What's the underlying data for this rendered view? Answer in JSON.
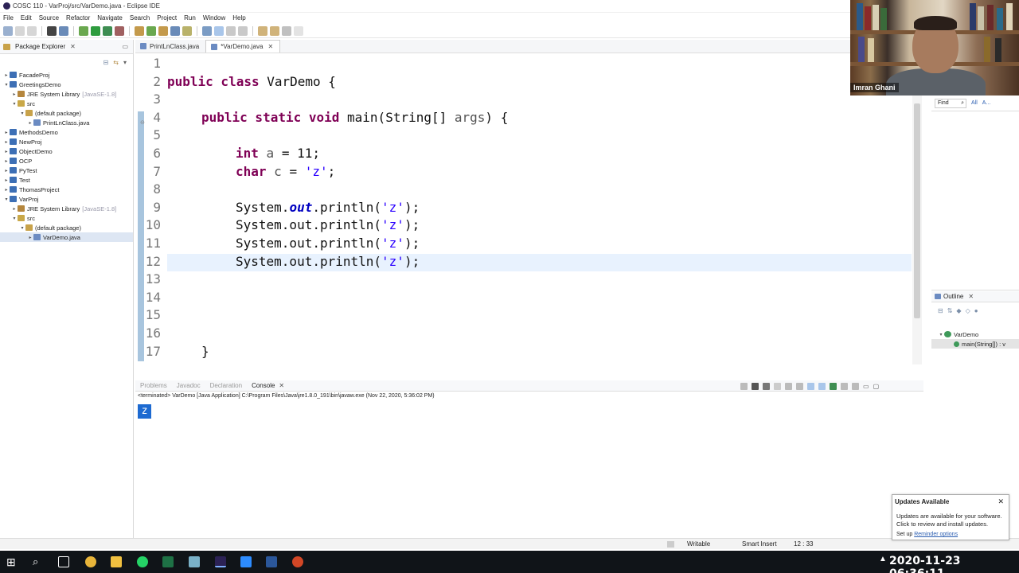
{
  "window": {
    "title": "COSC 110 - VarProj/src/VarDemo.java - Eclipse IDE"
  },
  "menu": [
    "File",
    "Edit",
    "Source",
    "Refactor",
    "Navigate",
    "Search",
    "Project",
    "Run",
    "Window",
    "Help"
  ],
  "package_explorer": {
    "title": "Package Explorer",
    "tree": [
      {
        "label": "FacadeProj",
        "suffix": "",
        "icon": "project-icon"
      },
      {
        "label": "GreetingsDemo",
        "suffix": "",
        "icon": "project-icon"
      },
      {
        "label": "JRE System Library",
        "suffix": "[JavaSE-1.8]",
        "icon": "library-icon"
      },
      {
        "label": "src",
        "suffix": "",
        "icon": "source-folder-icon"
      },
      {
        "label": "(default package)",
        "suffix": "",
        "icon": "package-icon"
      },
      {
        "label": "PrintLnClass.java",
        "suffix": "",
        "icon": "java-file-icon"
      },
      {
        "label": "MethodsDemo",
        "suffix": "",
        "icon": "project-icon"
      },
      {
        "label": "NewProj",
        "suffix": "",
        "icon": "project-icon"
      },
      {
        "label": "ObjectDemo",
        "suffix": "",
        "icon": "project-icon"
      },
      {
        "label": "OCP",
        "suffix": "",
        "icon": "project-icon"
      },
      {
        "label": "PyTest",
        "suffix": "",
        "icon": "project-icon"
      },
      {
        "label": "Test",
        "suffix": "",
        "icon": "project-icon"
      },
      {
        "label": "ThomasProject",
        "suffix": "",
        "icon": "project-icon"
      },
      {
        "label": "VarProj",
        "suffix": "",
        "icon": "project-icon"
      },
      {
        "label": "JRE System Library",
        "suffix": "[JavaSE-1.8]",
        "icon": "library-icon"
      },
      {
        "label": "src",
        "suffix": "",
        "icon": "source-folder-icon"
      },
      {
        "label": "(default package)",
        "suffix": "",
        "icon": "package-icon"
      },
      {
        "label": "VarDemo.java",
        "suffix": "",
        "icon": "java-file-icon"
      }
    ]
  },
  "editor": {
    "tabs": [
      {
        "label": "PrintLnClass.java"
      },
      {
        "label": "*VarDemo.java"
      }
    ],
    "line_numbers": [
      "1",
      "2",
      "3",
      "4",
      "5",
      "6",
      "7",
      "8",
      "9",
      "10",
      "11",
      "12",
      "13",
      "14",
      "15",
      "16",
      "17"
    ],
    "lines": [
      {
        "kw": "",
        "rest": ""
      },
      {
        "kw": "public class",
        "rest": " VarDemo {"
      },
      {
        "kw": "",
        "rest": ""
      },
      {
        "kw": "public static void",
        "rest": " main(String[] ",
        "var": "args",
        "rest2": ") {"
      },
      {
        "kw": "",
        "rest": ""
      },
      {
        "kw": "int",
        "rest": " ",
        "var": "a",
        "rest2": " = 11;"
      },
      {
        "kw": "char",
        "rest": " ",
        "var": "c",
        "rest2": " = ",
        "str": "'z'",
        "rest3": ";"
      },
      {
        "kw": "",
        "rest": ""
      },
      {
        "pre": "System.",
        "fld": "out",
        "mid": ".println(",
        "str": "'z'",
        "post": ");"
      },
      {
        "pre": "System.out.println(",
        "str": "'z'",
        "post": ");"
      },
      {
        "pre": "System.out.println(",
        "str": "'z'",
        "post": ");"
      },
      {
        "pre": "System.out.println(",
        "str": "'z'",
        "post": ");"
      },
      {
        "kw": "",
        "rest": ""
      },
      {
        "kw": "",
        "rest": ""
      },
      {
        "kw": "",
        "rest": ""
      },
      {
        "kw": "",
        "rest": ""
      },
      {
        "kw": "",
        "rest": "}"
      }
    ]
  },
  "webcam": {
    "name": "Imran Ghani"
  },
  "find": {
    "placeholder": "Find",
    "all": "All",
    "activate": "A..."
  },
  "outline": {
    "title": "Outline",
    "class_name": "VarDemo",
    "method": "main(String[]) : v"
  },
  "console": {
    "tabs": [
      "Problems",
      "Javadoc",
      "Declaration",
      "Console"
    ],
    "terminated": "<terminated> VarDemo [Java Application] C:\\Program Files\\Java\\jre1.8.0_191\\bin\\javaw.exe  (Nov 22, 2020, 5:36:02 PM)",
    "output": "z"
  },
  "status": {
    "writable": "Writable",
    "insert_mode": "Smart Insert",
    "position": "12 : 33"
  },
  "notification": {
    "title": "Updates Available",
    "body": "Updates are available for your software. Click to review and install updates.",
    "setup": "Set up",
    "link": "Reminder options"
  },
  "taskbar": {
    "clock": "2020-11-23 06:36:11"
  }
}
